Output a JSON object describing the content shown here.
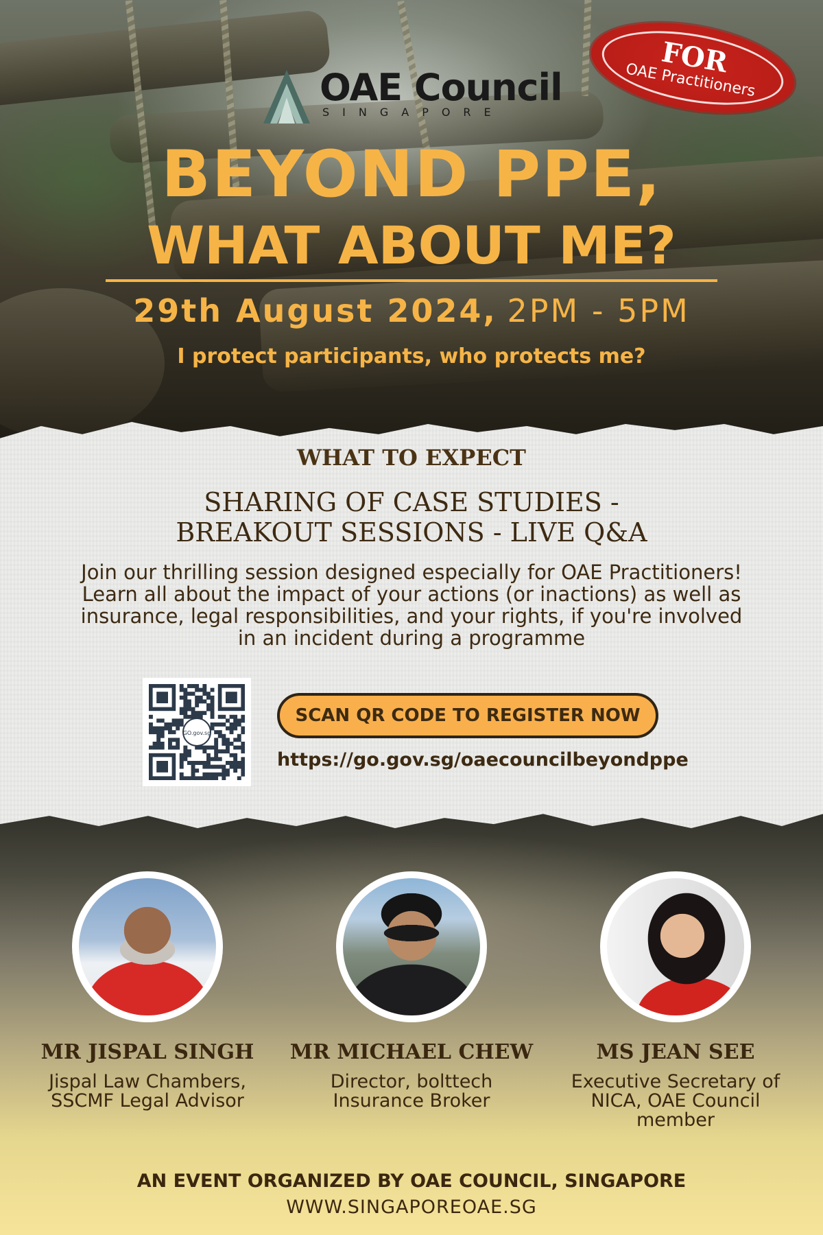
{
  "header": {
    "org_name": "OAE Council",
    "org_sub": "SINGAPORE",
    "stamp_for": "FOR",
    "stamp_audience": "OAE Practitioners"
  },
  "event": {
    "title_line1": "BEYOND PPE,",
    "title_line2": "WHAT ABOUT ME?",
    "date": "29th August 2024,",
    "time": "2PM - 5PM",
    "tagline": "I protect participants, who protects me?"
  },
  "content": {
    "section_heading": "WHAT TO EXPECT",
    "formats_line1": "SHARING OF CASE STUDIES -",
    "formats_line2": "BREAKOUT SESSIONS - LIVE Q&A",
    "description": "Join our thrilling session designed especially for OAE Practitioners! Learn all about the impact of your actions (or inactions) as well as insurance, legal responsibilities, and your rights, if you're involved in an incident during a programme",
    "qr_label": "GO.gov.sg",
    "cta_label": "SCAN QR CODE TO REGISTER NOW",
    "register_url": "https://go.gov.sg/oaecouncilbeyondppe"
  },
  "speakers": [
    {
      "name": "MR JISPAL SINGH",
      "role_line1": "Jispal Law Chambers,",
      "role_line2": "SSCMF Legal Advisor",
      "role_line3": ""
    },
    {
      "name": "MR MICHAEL CHEW",
      "role_line1": "Director, bolttech",
      "role_line2": "Insurance Broker",
      "role_line3": ""
    },
    {
      "name": "MS JEAN SEE",
      "role_line1": "Executive Secretary of",
      "role_line2": "NICA, OAE Council",
      "role_line3": "member"
    }
  ],
  "footer": {
    "organizer": "AN EVENT ORGANIZED BY OAE COUNCIL, SINGAPORE",
    "website": "WWW.SINGAPOREOAE.SG"
  },
  "colors": {
    "accent": "#f6b447",
    "stamp_red": "#b81d17",
    "text_brown": "#3d2a12",
    "button": "#f9b04c"
  }
}
